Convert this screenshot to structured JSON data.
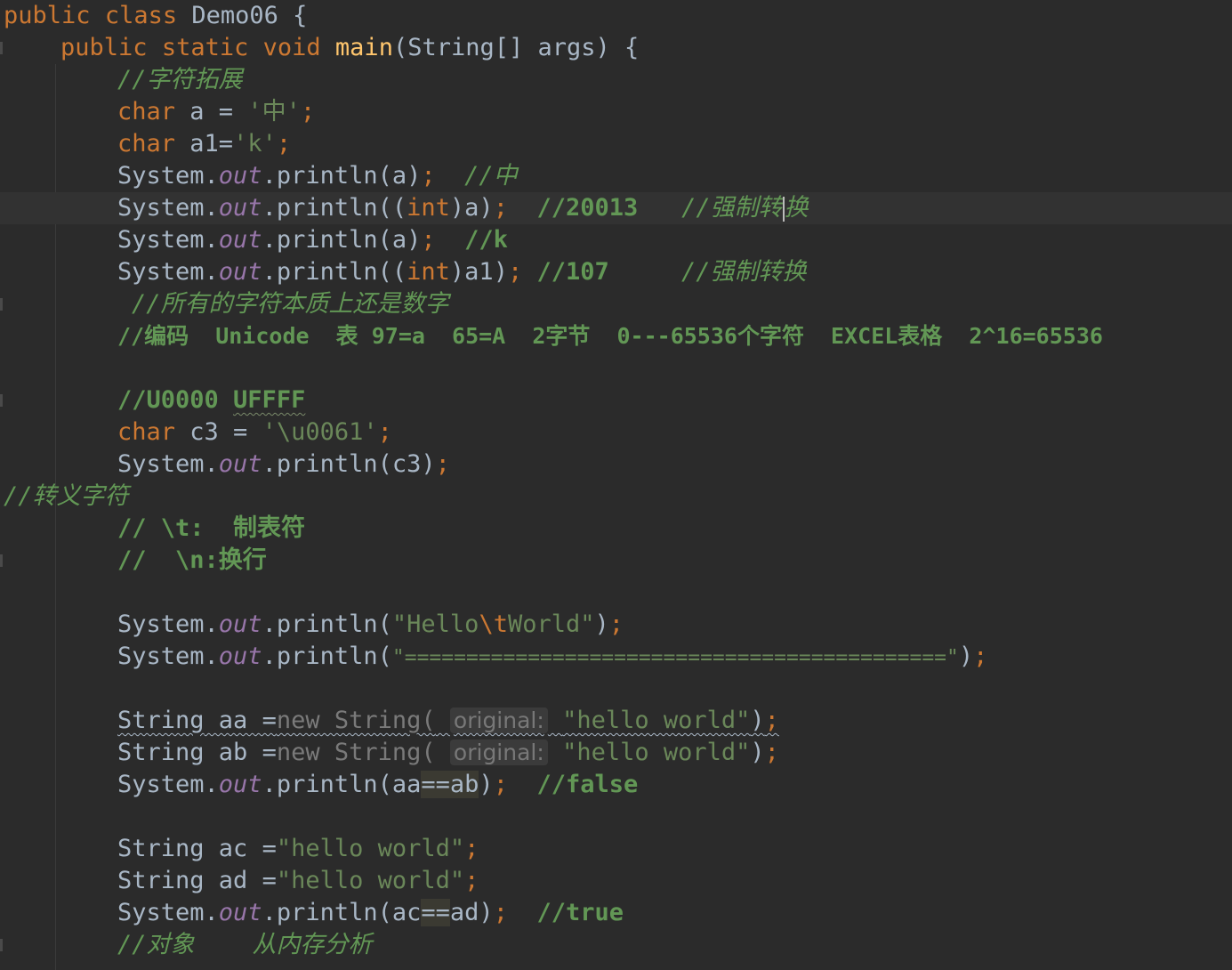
{
  "editor": {
    "lines": {
      "l0": {
        "kw1": "public",
        "kw2": "class",
        "name": "Demo06",
        "brace": "{"
      },
      "l1": {
        "kw1": "public",
        "kw2": "static",
        "kw3": "void",
        "fn": "main",
        "args": "(String[] args) {"
      },
      "l2": {
        "comment": "//字符拓展"
      },
      "l3": {
        "kw": "char",
        "rest": " a = ",
        "str": "'中'",
        "semi": ";"
      },
      "l4": {
        "kw": "char",
        "rest": " a1=",
        "str": "'k'",
        "semi": ";"
      },
      "l5": {
        "sys": "System.",
        "out": "out",
        "call": ".println(a)",
        "semi": ";",
        "comment": "//中"
      },
      "l6": {
        "sys": "System.",
        "out": "out",
        "call1": ".println((",
        "kw": "int",
        "call2": ")a)",
        "semi": ";",
        "comment1": "//20013",
        "comment2": "//强制转",
        "comment3": "换"
      },
      "l7": {
        "sys": "System.",
        "out": "out",
        "call": ".println(a)",
        "semi": ";",
        "comment": "//k"
      },
      "l8": {
        "sys": "System.",
        "out": "out",
        "call1": ".println((",
        "kw": "int",
        "call2": ")a1)",
        "semi": ";",
        "comment1": "//107",
        "comment2": "//强制转换"
      },
      "l9": {
        "comment": "//所有的字符本质上还是数字"
      },
      "l10": {
        "comment": "//编码  Unicode  表 97=a  65=A  2字节  0---65536个字符  EXCEL表格  2^16=65536"
      },
      "l12": {
        "comment1": "//U0000 ",
        "comment2": "UFFFF"
      },
      "l13": {
        "kw": "char",
        "rest": " c3 = ",
        "str": "'\\u0061'",
        "semi": ";"
      },
      "l14": {
        "sys": "System.",
        "out": "out",
        "call": ".println(c3)",
        "semi": ";"
      },
      "l15": {
        "comment": "//转义字符"
      },
      "l16": {
        "comment": "// \\t:  制表符"
      },
      "l17": {
        "comment": "//  \\n:换行"
      },
      "l19": {
        "sys": "System.",
        "out": "out",
        "call1": ".println(",
        "str1": "\"Hello",
        "esc": "\\t",
        "str2": "World\"",
        "call2": ")",
        "semi": ";"
      },
      "l20": {
        "sys": "System.",
        "out": "out",
        "call1": ".println(",
        "str": "\"============================================\"",
        "call2": ")",
        "semi": ";"
      },
      "l22": {
        "type": "String",
        "var": " aa =",
        "kw": "new",
        "cls": " String(",
        "hint": "original:",
        "str": "\"hello world\"",
        "close": ")",
        "semi": ";"
      },
      "l23": {
        "type": "String",
        "var": " ab =",
        "kw": "new",
        "cls": " String(",
        "hint": "original:",
        "str": "\"hello world\"",
        "close": ")",
        "semi": ";"
      },
      "l24": {
        "sys": "System.",
        "out": "out",
        "call1": ".println(aa",
        "op": "==",
        "var": "ab",
        "call2": ")",
        "semi": ";",
        "comment": "//false"
      },
      "l26": {
        "type": "String",
        "var": " ac =",
        "str": "\"hello world\"",
        "semi": ";"
      },
      "l27": {
        "type": "String",
        "var": " ad =",
        "str": "\"hello world\"",
        "semi": ";"
      },
      "l28": {
        "sys": "System.",
        "out": "out",
        "call1": ".println(ac",
        "op": "==",
        "var": "ad",
        "call2": ")",
        "semi": ";",
        "comment": "//true"
      },
      "l29": {
        "comment": "//对象    从内存分析"
      }
    }
  },
  "colors": {
    "background": "#2b2b2b",
    "keyword": "#cc7832",
    "string": "#6a8759",
    "comment": "#629755",
    "field": "#9876aa",
    "function": "#ffc66d",
    "text": "#a9b7c6"
  }
}
